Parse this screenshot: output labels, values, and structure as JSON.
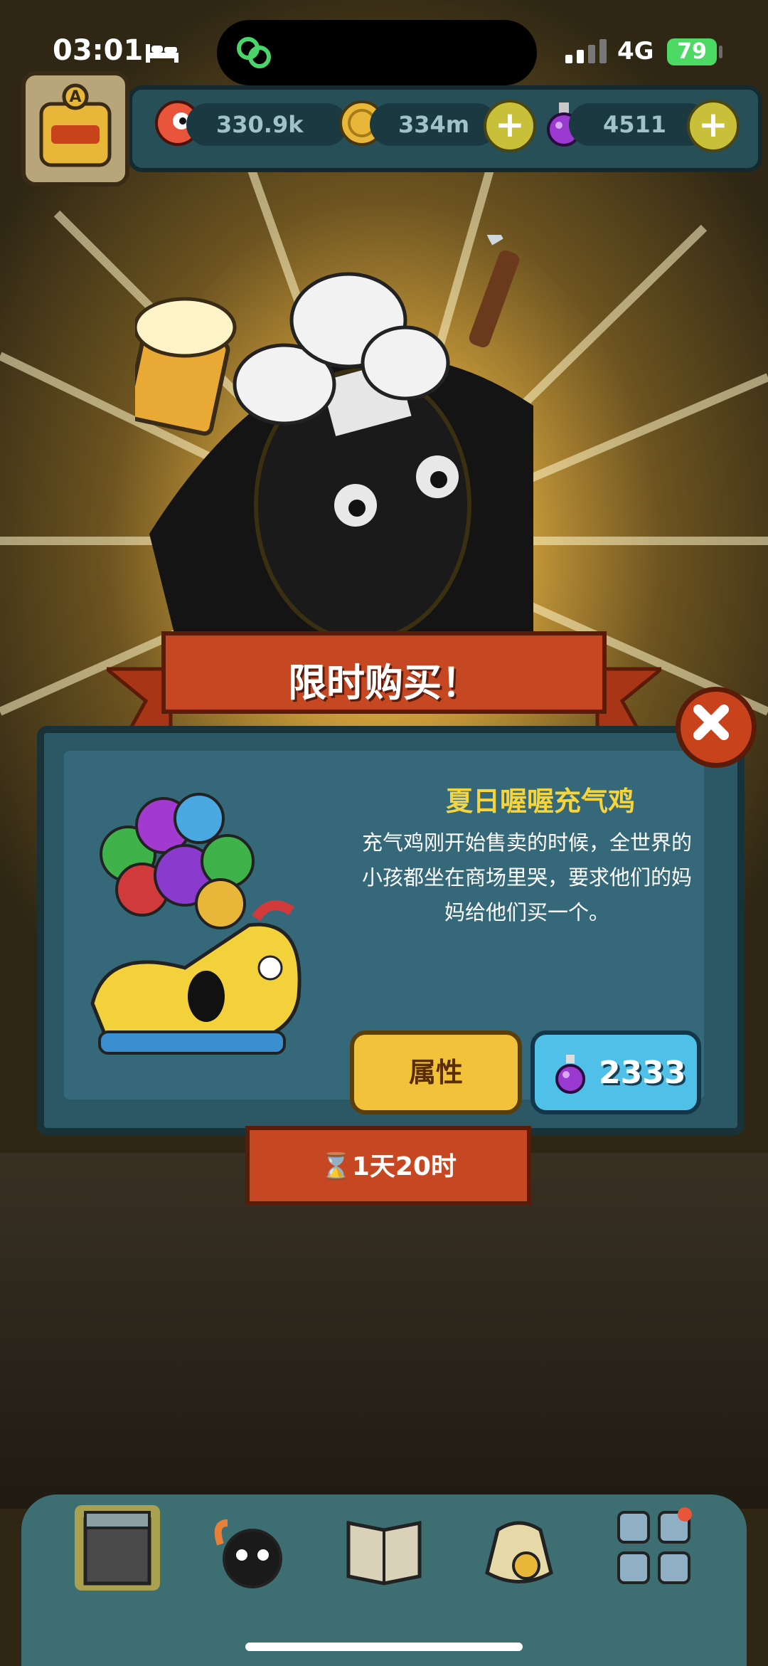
{
  "status_bar": {
    "time": "03:01",
    "network": "4G",
    "battery": "79"
  },
  "resources": {
    "eyes": "330.9k",
    "coins": "334m",
    "potions": "4511"
  },
  "offer": {
    "banner_title": "限时购买！",
    "item_name": "夏日喔喔充气鸡",
    "description_lines": [
      "充气鸡刚开始售卖的时候，全世界的",
      "小孩都坐在商场里哭，要求他们的妈",
      "妈给他们买一个。"
    ],
    "attributes_label": "属性",
    "price": "2333",
    "timer": "1天20时"
  },
  "icons": {
    "status": [
      "bed-icon",
      "app-link-icon",
      "signal-icon"
    ],
    "resources": [
      "eyeball-icon",
      "coin-icon",
      "potion-icon",
      "plus-icon"
    ],
    "nav": [
      "shop-nav-icon",
      "monster-nav-icon",
      "book-nav-icon",
      "bag-nav-icon",
      "grid-nav-icon"
    ]
  },
  "colors": {
    "banner": "#c64823",
    "panel": "#2c5866",
    "title": "#f6d43a",
    "attr_button": "#f2c23a",
    "price_button": "#4fc0e8",
    "close": "#c8431c"
  }
}
